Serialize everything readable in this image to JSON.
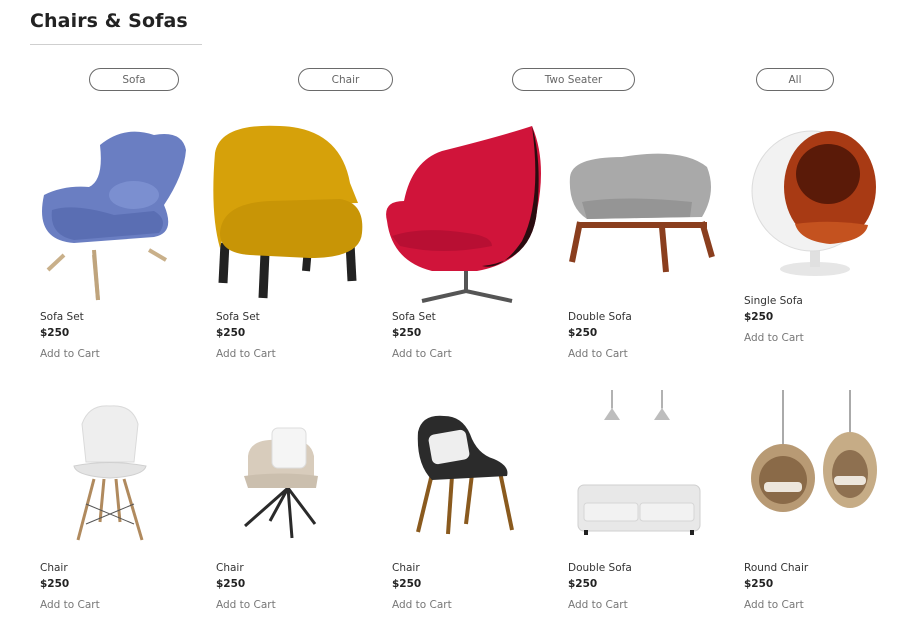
{
  "section": {
    "title": "Chairs & Sofas"
  },
  "filters": [
    {
      "label": "Sofa"
    },
    {
      "label": "Chair"
    },
    {
      "label": "Two Seater"
    },
    {
      "label": "All"
    }
  ],
  "products": [
    {
      "name": "Sofa Set",
      "price": "$250",
      "cta": "Add to Cart",
      "image_icon": "blue-wingback-chair-icon"
    },
    {
      "name": "Sofa Set",
      "price": "$250",
      "cta": "Add to Cart",
      "image_icon": "yellow-tub-chair-icon"
    },
    {
      "name": "Sofa Set",
      "price": "$250",
      "cta": "Add to Cart",
      "image_icon": "red-egg-chair-icon"
    },
    {
      "name": "Double Sofa",
      "price": "$250",
      "cta": "Add to Cart",
      "image_icon": "grey-lounge-chair-icon"
    },
    {
      "name": "Single Sofa",
      "price": "$250",
      "cta": "Add to Cart",
      "image_icon": "white-ball-chair-icon"
    },
    {
      "name": "Chair",
      "price": "$250",
      "cta": "Add to Cart",
      "image_icon": "white-eiffel-chair-icon"
    },
    {
      "name": "Chair",
      "price": "$250",
      "cta": "Add to Cart",
      "image_icon": "beige-swivel-chair-icon"
    },
    {
      "name": "Chair",
      "price": "$250",
      "cta": "Add to Cart",
      "image_icon": "black-dining-chair-icon"
    },
    {
      "name": "Double Sofa",
      "price": "$250",
      "cta": "Add to Cart",
      "image_icon": "white-sofa-with-lamps-icon"
    },
    {
      "name": "Round Chair",
      "price": "$250",
      "cta": "Add to Cart",
      "image_icon": "hanging-rattan-chairs-icon"
    }
  ],
  "colors": {
    "text": "#222222",
    "muted": "#777777",
    "border": "#6a6a6a"
  }
}
